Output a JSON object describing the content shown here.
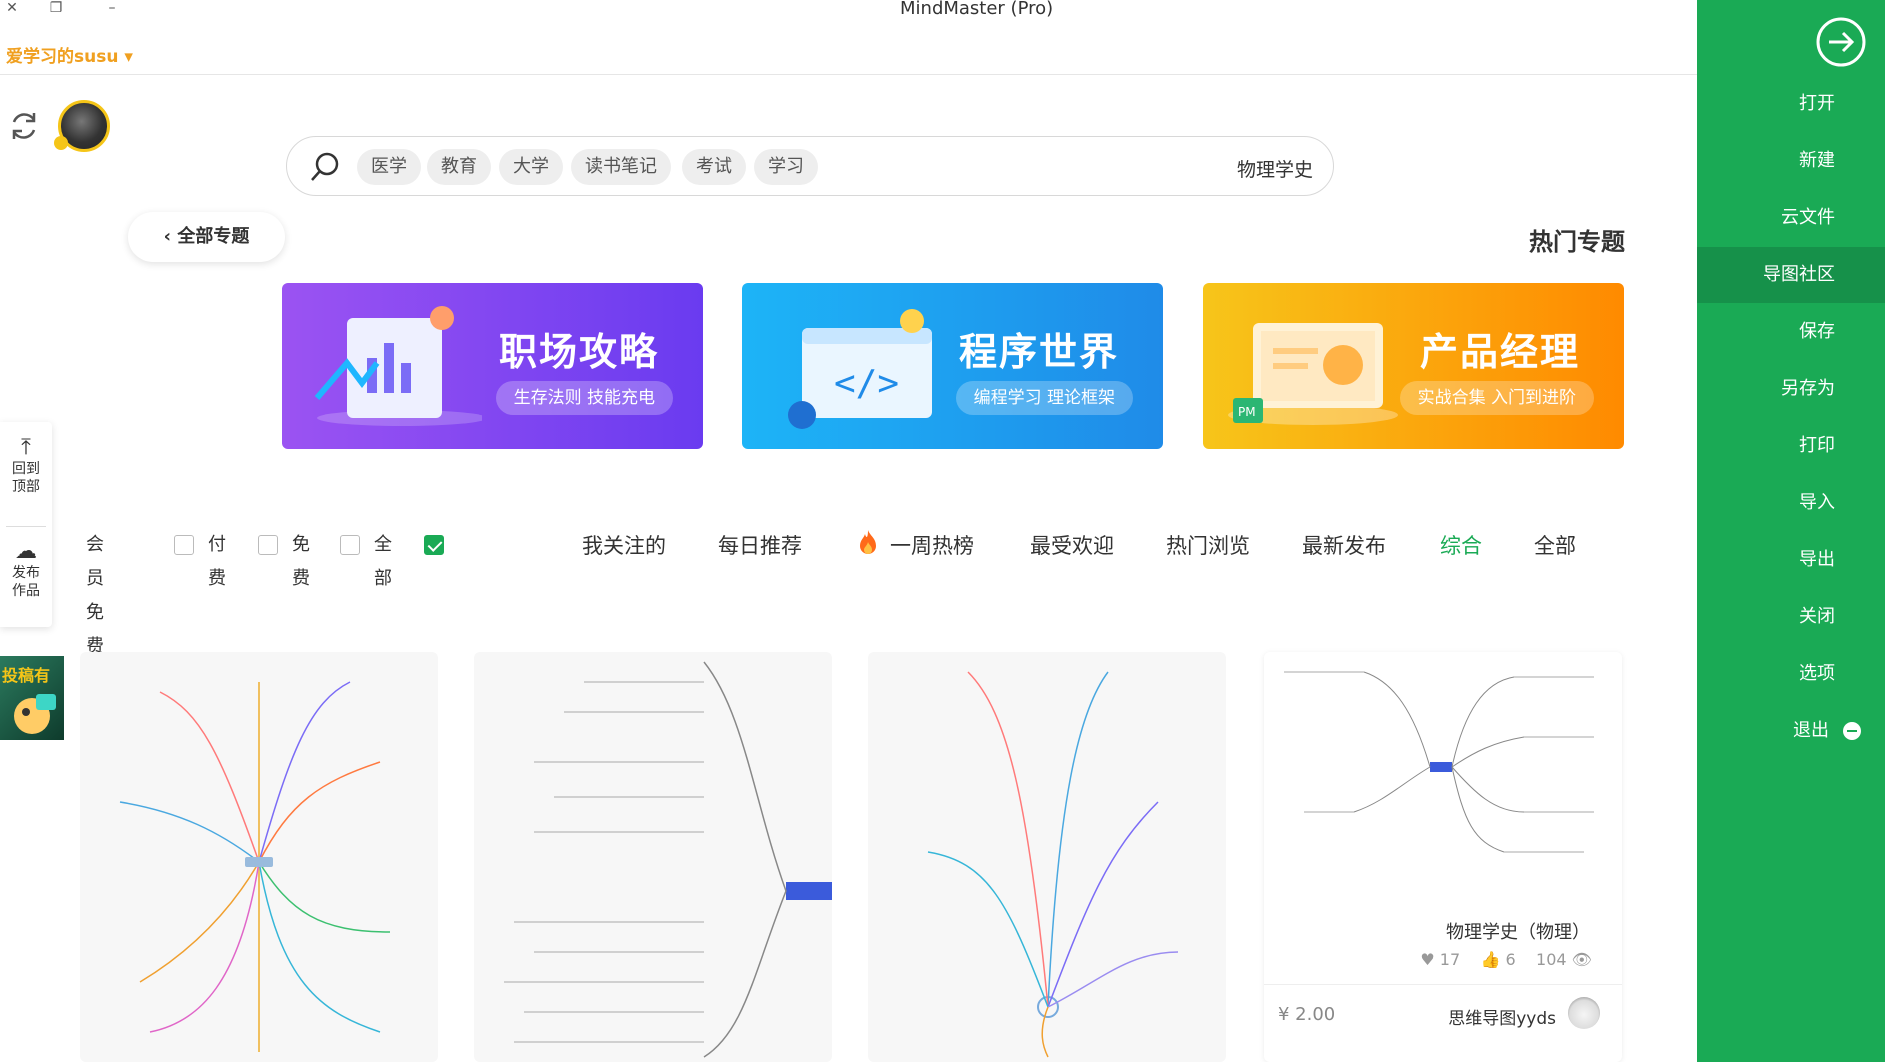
{
  "window": {
    "title": "MindMaster (Pro)",
    "controls": [
      "close",
      "restore",
      "minimize"
    ]
  },
  "user": {
    "name": "爱学习的susu"
  },
  "search": {
    "value": "物理学史",
    "tags": [
      "学习",
      "考试",
      "读书笔记",
      "大学",
      "教育",
      "医学"
    ]
  },
  "buttons": {
    "all_topics": "全部专题"
  },
  "section": {
    "hot_topics": "热门专题"
  },
  "banners": [
    {
      "title": "产品经理",
      "subtitle": "实战合集 入门到进阶",
      "color_start": "#f7c51a",
      "color_end": "#ff8a00"
    },
    {
      "title": "程序世界",
      "subtitle": "编程学习 理论框架",
      "color_start": "#1db4f7",
      "color_end": "#1f8be8"
    },
    {
      "title": "职场攻略",
      "subtitle": "生存法则 技能充电",
      "color_start": "#9b53f2",
      "color_end": "#6a3bf0"
    }
  ],
  "tabs": {
    "items": [
      "全部",
      "综合",
      "最新发布",
      "热门浏览",
      "最受欢迎",
      "一周热榜",
      "每日推荐",
      "我关注的"
    ],
    "active": "综合"
  },
  "filters": {
    "items": [
      "全部",
      "免费",
      "付费",
      "会员免费"
    ],
    "checked": "全部"
  },
  "float_bar": {
    "back_to_top": "回到顶部",
    "publish": "发布作品"
  },
  "promo": {
    "text": "投稿有"
  },
  "cards": [
    {
      "title": "物理学史（物理）",
      "views": "104",
      "likes": "6",
      "favorites": "17",
      "author": "思维导图yyds",
      "price": "¥ 2.00"
    }
  ],
  "sidebar": {
    "items": [
      "打开",
      "新建",
      "云文件",
      "导图社区",
      "保存",
      "另存为",
      "打印",
      "导入",
      "导出",
      "关闭",
      "选项",
      "退出"
    ],
    "active": "导图社区"
  },
  "colors": {
    "accent": "#1aaa55",
    "username": "#f0a020"
  }
}
